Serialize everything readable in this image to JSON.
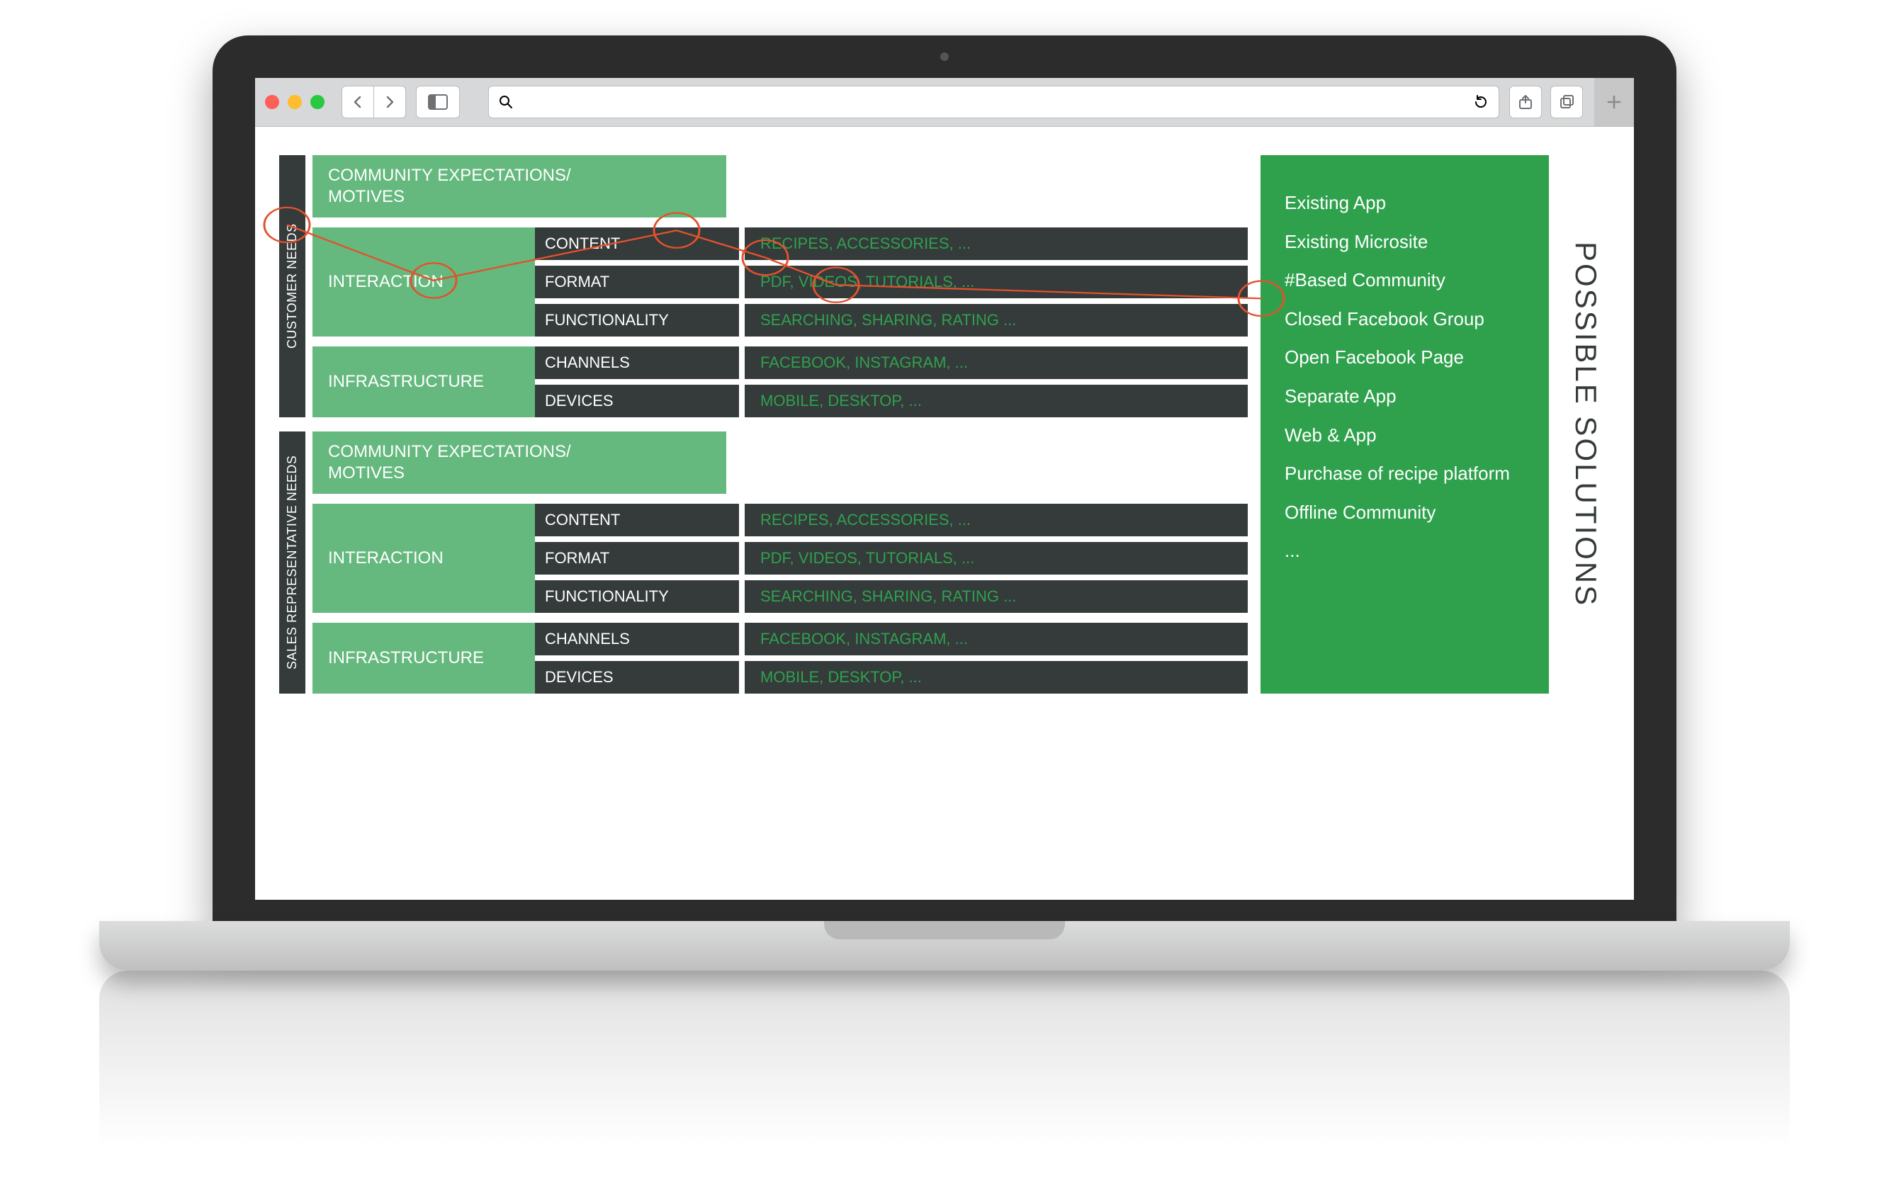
{
  "browser": {
    "url_value": "",
    "url_placeholder": ""
  },
  "solutions_panel": {
    "title": "POSSIBLE SOLUTIONS",
    "items": [
      "Existing App",
      "Existing Microsite",
      "#Based Community",
      "Closed Facebook Group",
      "Open Facebook Page",
      "Separate App",
      "Web & App",
      "Purchase of recipe platform",
      "Offline Community",
      "..."
    ]
  },
  "sections": [
    {
      "vlabel": "CUSTOMER NEEDS",
      "community_title": "COMMUNITY EXPECTATIONS/ MOTIVES",
      "groups": [
        {
          "title": "INTERACTION",
          "rows": [
            {
              "label": "CONTENT",
              "value": "RECIPES, ACCESSORIES, ..."
            },
            {
              "label": "FORMAT",
              "value": "PDF, VIDEOS, TUTORIALS, ..."
            },
            {
              "label": "FUNCTIONALITY",
              "value": "SEARCHING, SHARING, RATING ..."
            }
          ]
        },
        {
          "title": "INFRASTRUCTURE",
          "rows": [
            {
              "label": "CHANNELS",
              "value": "FACEBOOK, INSTAGRAM, ..."
            },
            {
              "label": "DEVICES",
              "value": "MOBILE, DESKTOP, ..."
            }
          ]
        }
      ]
    },
    {
      "vlabel": "SALES REPRESENTATIVE NEEDS",
      "community_title": "COMMUNITY EXPECTATIONS/ MOTIVES",
      "groups": [
        {
          "title": "INTERACTION",
          "rows": [
            {
              "label": "CONTENT",
              "value": "RECIPES, ACCESSORIES, ..."
            },
            {
              "label": "FORMAT",
              "value": "PDF, VIDEOS, TUTORIALS, ..."
            },
            {
              "label": "FUNCTIONALITY",
              "value": "SEARCHING, SHARING, RATING ..."
            }
          ]
        },
        {
          "title": "INFRASTRUCTURE",
          "rows": [
            {
              "label": "CHANNELS",
              "value": "FACEBOOK, INSTAGRAM, ..."
            },
            {
              "label": "DEVICES",
              "value": "MOBILE, DESKTOP, ..."
            }
          ]
        }
      ]
    }
  ]
}
